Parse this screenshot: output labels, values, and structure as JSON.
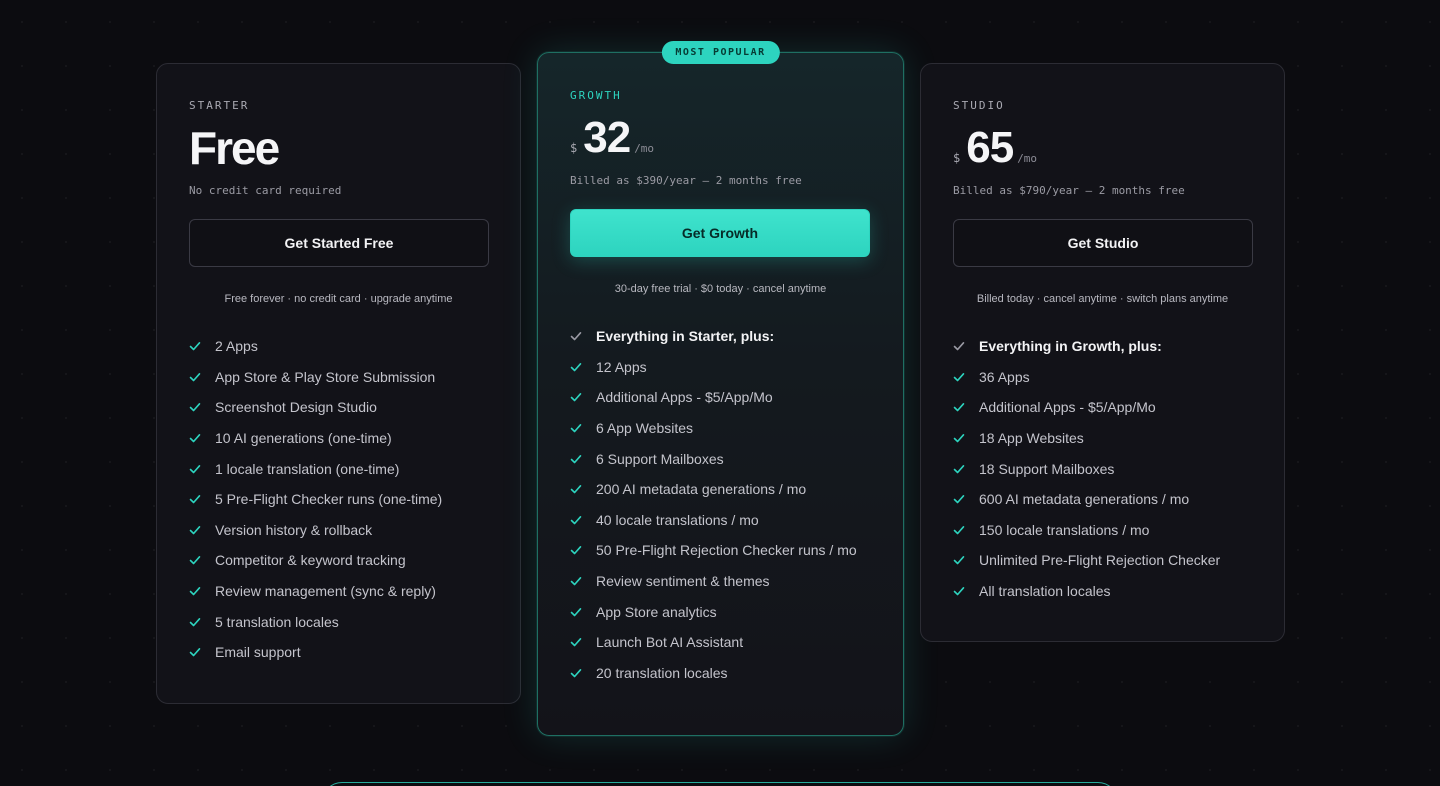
{
  "colors": {
    "accent": "#2dd4bf",
    "background": "#0c0c10",
    "card": "#121218"
  },
  "icons": {
    "check": "check-icon"
  },
  "plans": {
    "starter": {
      "name": "STARTER",
      "price_text": "Free",
      "subtitle": "No credit card required",
      "cta": "Get Started Free",
      "note": "Free forever · no credit card · upgrade anytime",
      "features": [
        "2 Apps",
        "App Store & Play Store Submission",
        "Screenshot Design Studio",
        "10 AI generations (one-time)",
        "1 locale translation (one-time)",
        "5 Pre-Flight Checker runs (one-time)",
        "Version history & rollback",
        "Competitor & keyword tracking",
        "Review management (sync & reply)",
        "5 translation locales",
        "Email support"
      ]
    },
    "growth": {
      "badge": "MOST POPULAR",
      "name": "GROWTH",
      "currency": "$",
      "amount": "32",
      "period": "/mo",
      "subtitle": "Billed as $390/year — 2 months free",
      "cta": "Get Growth",
      "note": "30-day free trial · $0 today · cancel anytime",
      "lead": "Everything in Starter, plus:",
      "features": [
        "12 Apps",
        "Additional Apps - $5/App/Mo",
        "6 App Websites",
        "6 Support Mailboxes",
        "200 AI metadata generations / mo",
        "40 locale translations / mo",
        "50 Pre-Flight Rejection Checker runs / mo",
        "Review sentiment & themes",
        "App Store analytics",
        "Launch Bot AI Assistant",
        "20 translation locales"
      ]
    },
    "studio": {
      "name": "STUDIO",
      "currency": "$",
      "amount": "65",
      "period": "/mo",
      "subtitle": "Billed as $790/year — 2 months free",
      "cta": "Get Studio",
      "note": "Billed today · cancel anytime · switch plans anytime",
      "lead": "Everything in Growth, plus:",
      "features": [
        "36 Apps",
        "Additional Apps - $5/App/Mo",
        "18 App Websites",
        "18 Support Mailboxes",
        "600 AI metadata generations / mo",
        "150 locale translations / mo",
        "Unlimited Pre-Flight Rejection Checker",
        "All translation locales"
      ]
    }
  }
}
